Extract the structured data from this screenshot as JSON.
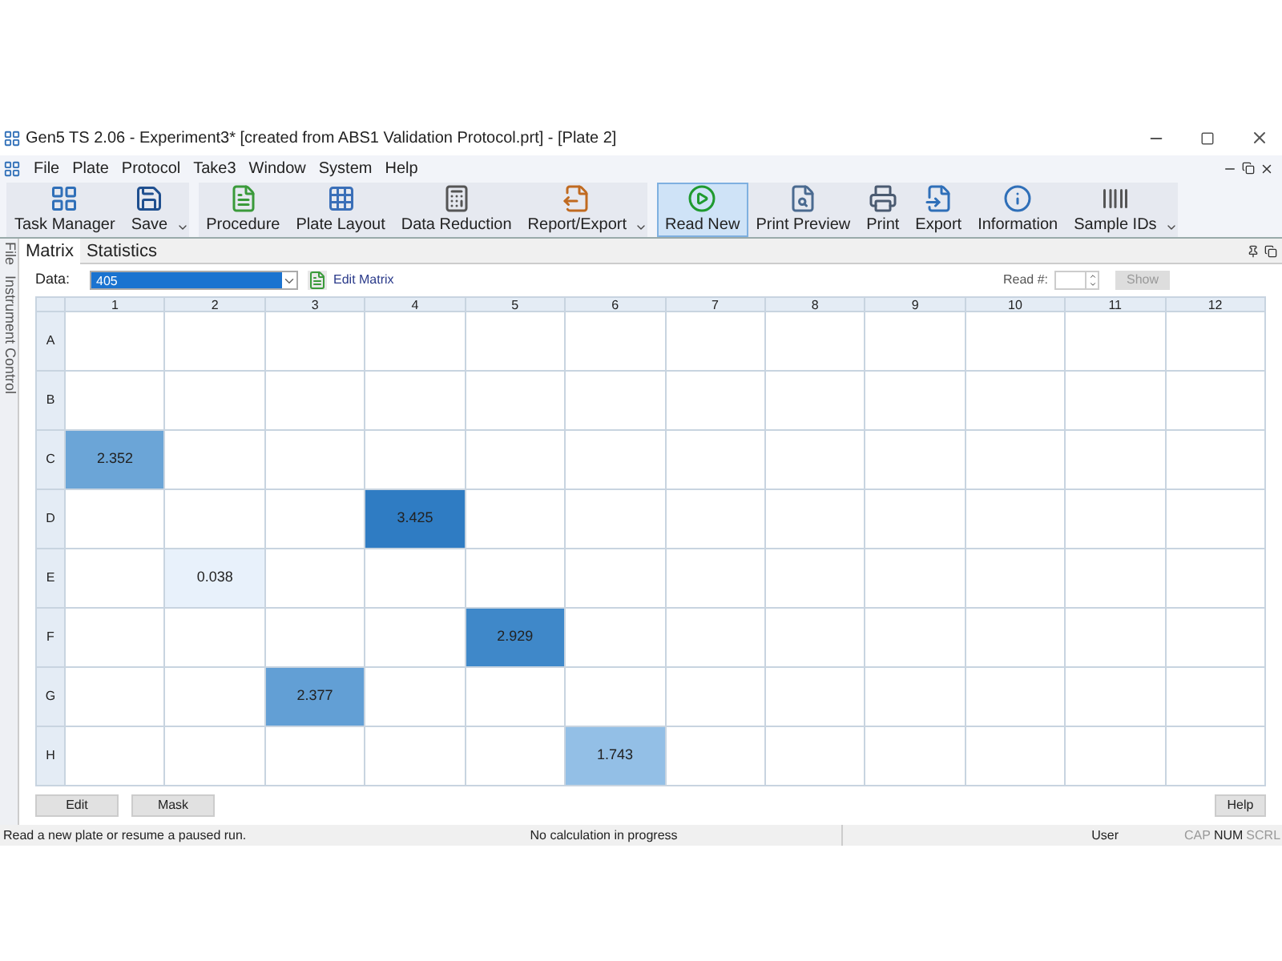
{
  "window": {
    "title": "Gen5 TS 2.06 - Experiment3* [created from ABS1 Validation Protocol.prt] - [Plate 2]"
  },
  "menu": [
    "File",
    "Plate",
    "Protocol",
    "Take3",
    "Window",
    "System",
    "Help"
  ],
  "toolbar": [
    [
      {
        "label": "Task Manager",
        "selected": false
      },
      {
        "label": "Save",
        "selected": false
      }
    ],
    [
      {
        "label": "Procedure",
        "selected": false
      },
      {
        "label": "Plate Layout",
        "selected": false
      },
      {
        "label": "Data Reduction",
        "selected": false
      },
      {
        "label": "Report/Export",
        "selected": false
      }
    ],
    [
      {
        "label": "Read New",
        "selected": true
      },
      {
        "label": "Print Preview",
        "selected": false
      },
      {
        "label": "Print",
        "selected": false
      },
      {
        "label": "Export",
        "selected": false
      },
      {
        "label": "Information",
        "selected": false
      },
      {
        "label": "Sample IDs",
        "selected": false
      }
    ]
  ],
  "side_tabs": [
    "File",
    "Instrument Control"
  ],
  "tabs": [
    {
      "label": "Matrix",
      "selected": true
    },
    {
      "label": "Statistics",
      "selected": false
    }
  ],
  "data_select": {
    "label": "Data:",
    "value": "405"
  },
  "edit_matrix": "Edit Matrix",
  "read_number": {
    "label": "Read #:",
    "button": "Show"
  },
  "table": {
    "columns": [
      "1",
      "2",
      "3",
      "4",
      "5",
      "6",
      "7",
      "8",
      "9",
      "10",
      "11",
      "12"
    ],
    "rows": [
      {
        "label": "A",
        "cells": [
          null,
          null,
          null,
          null,
          null,
          null,
          null,
          null,
          null,
          null,
          null,
          null
        ]
      },
      {
        "label": "B",
        "cells": [
          null,
          null,
          null,
          null,
          null,
          null,
          null,
          null,
          null,
          null,
          null,
          null
        ]
      },
      {
        "label": "C",
        "cells": [
          {
            "value": "2.352",
            "color": "#6ba5d7"
          },
          null,
          null,
          null,
          null,
          null,
          null,
          null,
          null,
          null,
          null,
          null
        ]
      },
      {
        "label": "D",
        "cells": [
          null,
          null,
          null,
          {
            "value": "3.425",
            "color": "#2f7cc3"
          },
          null,
          null,
          null,
          null,
          null,
          null,
          null,
          null
        ]
      },
      {
        "label": "E",
        "cells": [
          null,
          {
            "value": "0.038",
            "color": "#e8f1fb"
          },
          null,
          null,
          null,
          null,
          null,
          null,
          null,
          null,
          null,
          null
        ]
      },
      {
        "label": "F",
        "cells": [
          null,
          null,
          null,
          null,
          {
            "value": "2.929",
            "color": "#3f88c9"
          },
          null,
          null,
          null,
          null,
          null,
          null,
          null
        ]
      },
      {
        "label": "G",
        "cells": [
          null,
          null,
          {
            "value": "2.377",
            "color": "#629fd5"
          },
          null,
          null,
          null,
          null,
          null,
          null,
          null,
          null,
          null
        ]
      },
      {
        "label": "H",
        "cells": [
          null,
          null,
          null,
          null,
          null,
          {
            "value": "1.743",
            "color": "#93bfe6"
          },
          null,
          null,
          null,
          null,
          null,
          null
        ]
      }
    ]
  },
  "buttons": [
    "Edit",
    "Mask"
  ],
  "help_button": "Help",
  "status_bar": {
    "message": "Read a new plate or resume a paused run.",
    "calc": "No calculation in progress",
    "user": "User",
    "indicators": [
      {
        "label": "CAP",
        "on": false
      },
      {
        "label": "NUM",
        "on": true
      },
      {
        "label": "SCRL",
        "on": false
      }
    ]
  }
}
